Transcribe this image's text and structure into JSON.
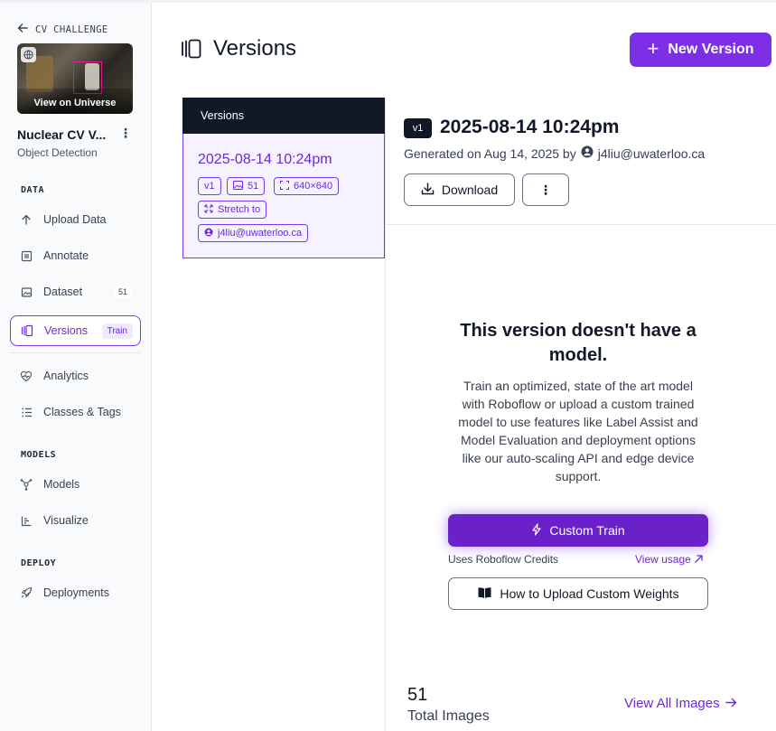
{
  "sidebar": {
    "back_label": "CV CHALLENGE",
    "thumbnail_caption": "View on Universe",
    "project_name": "Nuclear CV V...",
    "project_type": "Object Detection",
    "sections": {
      "data": "DATA",
      "models": "MODELS",
      "deploy": "DEPLOY"
    },
    "items": [
      {
        "label": "Upload Data",
        "icon": "upload-icon"
      },
      {
        "label": "Annotate",
        "icon": "annotate-icon"
      },
      {
        "label": "Dataset",
        "icon": "dataset-icon",
        "badge": "51"
      },
      {
        "label": "Versions",
        "icon": "versions-icon",
        "badge": "Train",
        "active": true
      },
      {
        "label": "Analytics",
        "icon": "analytics-icon"
      },
      {
        "label": "Classes & Tags",
        "icon": "classes-icon"
      },
      {
        "label": "Models",
        "icon": "models-icon"
      },
      {
        "label": "Visualize",
        "icon": "visualize-icon"
      },
      {
        "label": "Deployments",
        "icon": "rocket-icon"
      }
    ]
  },
  "header": {
    "title": "Versions",
    "new_version_label": "New Version"
  },
  "versions_list": {
    "header": "Versions",
    "items": [
      {
        "date": "2025-08-14 10:24pm",
        "version_tag": "v1",
        "image_count": "51",
        "resize": "640×640",
        "transform": "Stretch to",
        "author": "j4liu@uwaterloo.ca"
      }
    ]
  },
  "detail": {
    "version_badge": "v1",
    "title": "2025-08-14 10:24pm",
    "generated_prefix": "Generated on Aug 14, 2025 by",
    "author": "j4liu@uwaterloo.ca",
    "download_label": "Download",
    "no_model_title": "This version doesn't have a model.",
    "no_model_desc": "Train an optimized, state of the art model with Roboflow or upload a custom trained model to use features like Label Assist and Model Evaluation and deployment options like our auto-scaling API and edge device support.",
    "custom_train_label": "Custom Train",
    "credits_note": "Uses Roboflow Credits",
    "view_usage_label": "View usage",
    "upload_weights_label": "How to Upload Custom Weights",
    "total_images": "51",
    "total_images_label": "Total Images",
    "view_all_label": "View All Images"
  },
  "colors": {
    "accent": "#7c3aed",
    "button_primary": "#7c2fe6",
    "sidebar_bg": "#f9fafb",
    "list_header_bg": "#111827"
  }
}
